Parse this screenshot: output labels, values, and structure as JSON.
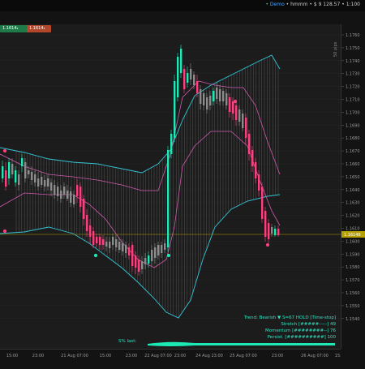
{
  "topbar": {
    "account_type": "Demo",
    "account_user": "hmmm",
    "balance": "$ 9 128.57",
    "leverage": "1:100"
  },
  "position_chips": {
    "buy": "1.1614₂",
    "sell": "1.1614₂"
  },
  "scale_label": "50 pips",
  "current_price": "1.16148",
  "price_ticks": [
    "1.1760",
    "1.1750",
    "1.1740",
    "1.1730",
    "1.1720",
    "1.1710",
    "1.1700",
    "1.1690",
    "1.1680",
    "1.1670",
    "1.1660",
    "1.1650",
    "1.1640",
    "1.1630",
    "1.1620",
    "1.1610",
    "1.1600",
    "1.1590",
    "1.1580",
    "1.1570",
    "1.1560",
    "1.1550",
    "1.1540"
  ],
  "time_ticks": [
    "15:00",
    "23:00",
    "21 Aug 07:00",
    "15:00",
    "23:00",
    "22 Aug 07:00",
    "23:00",
    "24 Aug 23:00",
    "25 Aug 07:00",
    "23:00",
    "26 Aug 07:00",
    "15:00"
  ],
  "status": {
    "trend": "Trend: Bearish ▼  S=67  HOLD  [Time-stop]",
    "stretch": "Stretch  [#####-----]  49",
    "momentum": "Momentum [########--]  76",
    "persist": "Persist. [##########]  100"
  },
  "s_label": "S% last:",
  "colors": {
    "bull": "#1de9b6",
    "bear": "#ff3d7f",
    "neutral": "#8c8c8c",
    "band_outer": "#34c6d6",
    "band_inner": "#d05bb0",
    "price_line": "#b5a000"
  }
}
